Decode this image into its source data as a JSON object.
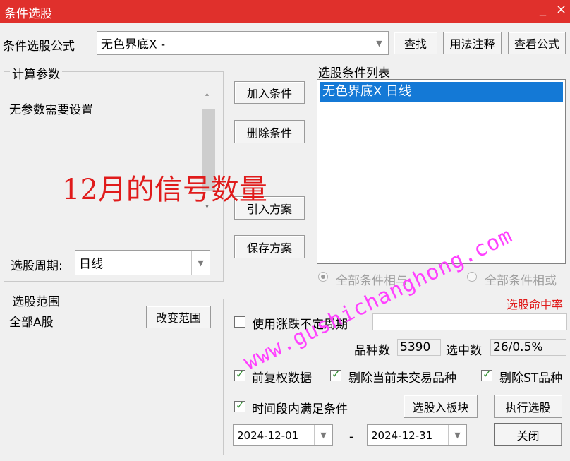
{
  "window": {
    "title": "条件选股",
    "minimize": "_",
    "close": "×"
  },
  "formula": {
    "label": "条件选股公式",
    "value": "无色界底X  -",
    "find_label": "查找",
    "usage_label": "用法注释",
    "view_label": "查看公式"
  },
  "params": {
    "group_label": "计算参数",
    "message": "无参数需要设置",
    "period_label": "选股周期:",
    "period_value": "日线"
  },
  "actions": {
    "add_label": "加入条件",
    "delete_label": "删除条件",
    "import_label": "引入方案",
    "save_label": "保存方案"
  },
  "condition_list": {
    "label": "选股条件列表",
    "items": [
      "无色界底X  日线"
    ],
    "radio_and": "全部条件相与",
    "radio_or": "全部条件相或"
  },
  "scope": {
    "group_label": "选股范围",
    "value": "全部A股",
    "change_label": "改变范围"
  },
  "options": {
    "variable_period_label": "使用涨跌不定周期",
    "hit_rate": "选股命中率",
    "count_label": "品种数",
    "count_value": "5390",
    "selected_label": "选中数",
    "selected_value": "26/0.5%",
    "adj_label": "前复权数据",
    "exclude_suspended_label": "剔除当前未交易品种",
    "exclude_st_label": "剔除ST品种",
    "period_condition_label": "时间段内满足条件",
    "to_block_label": "选股入板块",
    "run_label": "执行选股",
    "close_label": "关闭",
    "date_from": "2024-12-01",
    "date_sep": "-",
    "date_to": "2024-12-31"
  },
  "annotation": {
    "text": "12月的信号数量"
  },
  "watermark": {
    "text": "www.gushichanghong.com"
  },
  "colors": {
    "titlebar": "#e0302c",
    "selection": "#1479d6",
    "annotation": "#e01b1b",
    "watermark": "#ff40ff",
    "hit_rate": "#e01b1b"
  }
}
